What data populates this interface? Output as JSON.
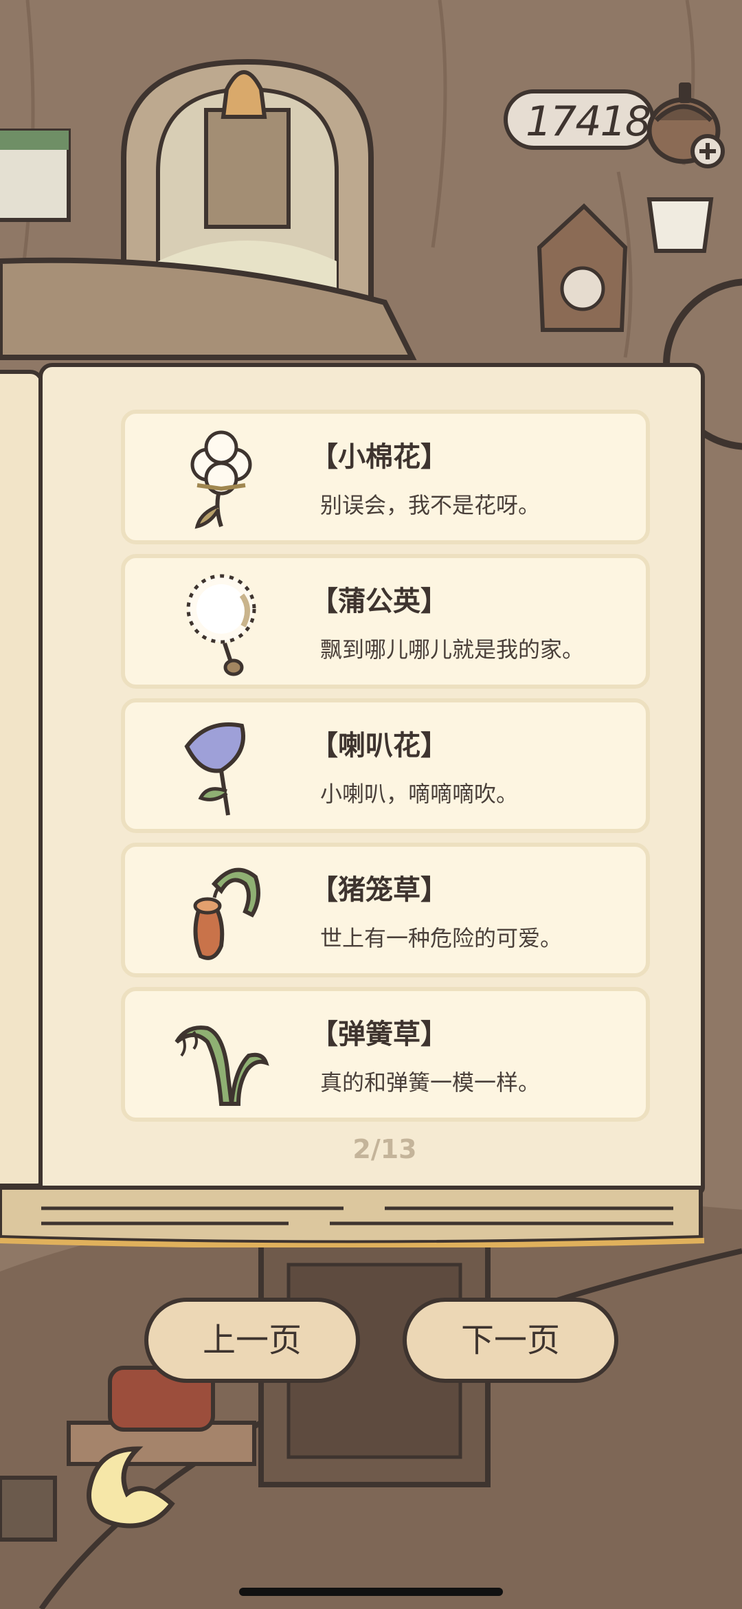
{
  "currency": {
    "value": "174186"
  },
  "entries": [
    {
      "name": "【小棉花】",
      "desc": "别误会，我不是花呀。",
      "icon": "cotton-icon"
    },
    {
      "name": "【蒲公英】",
      "desc": "飘到哪儿哪儿就是我的家。",
      "icon": "dandelion-icon"
    },
    {
      "name": "【喇叭花】",
      "desc": "小喇叭，嘀嘀嘀吹。",
      "icon": "morning-glory-icon"
    },
    {
      "name": "【猪笼草】",
      "desc": "世上有一种危险的可爱。",
      "icon": "pitcher-plant-icon"
    },
    {
      "name": "【弹簧草】",
      "desc": "真的和弹簧一模一样。",
      "icon": "spring-grass-icon"
    }
  ],
  "pager": {
    "text": "2/13"
  },
  "buttons": {
    "prev": "上一页",
    "next": "下一页"
  },
  "colors": {
    "outline": "#3e342f",
    "page": "#f5ead2",
    "card": "#fdf5e1",
    "button": "#ecd7b5"
  }
}
